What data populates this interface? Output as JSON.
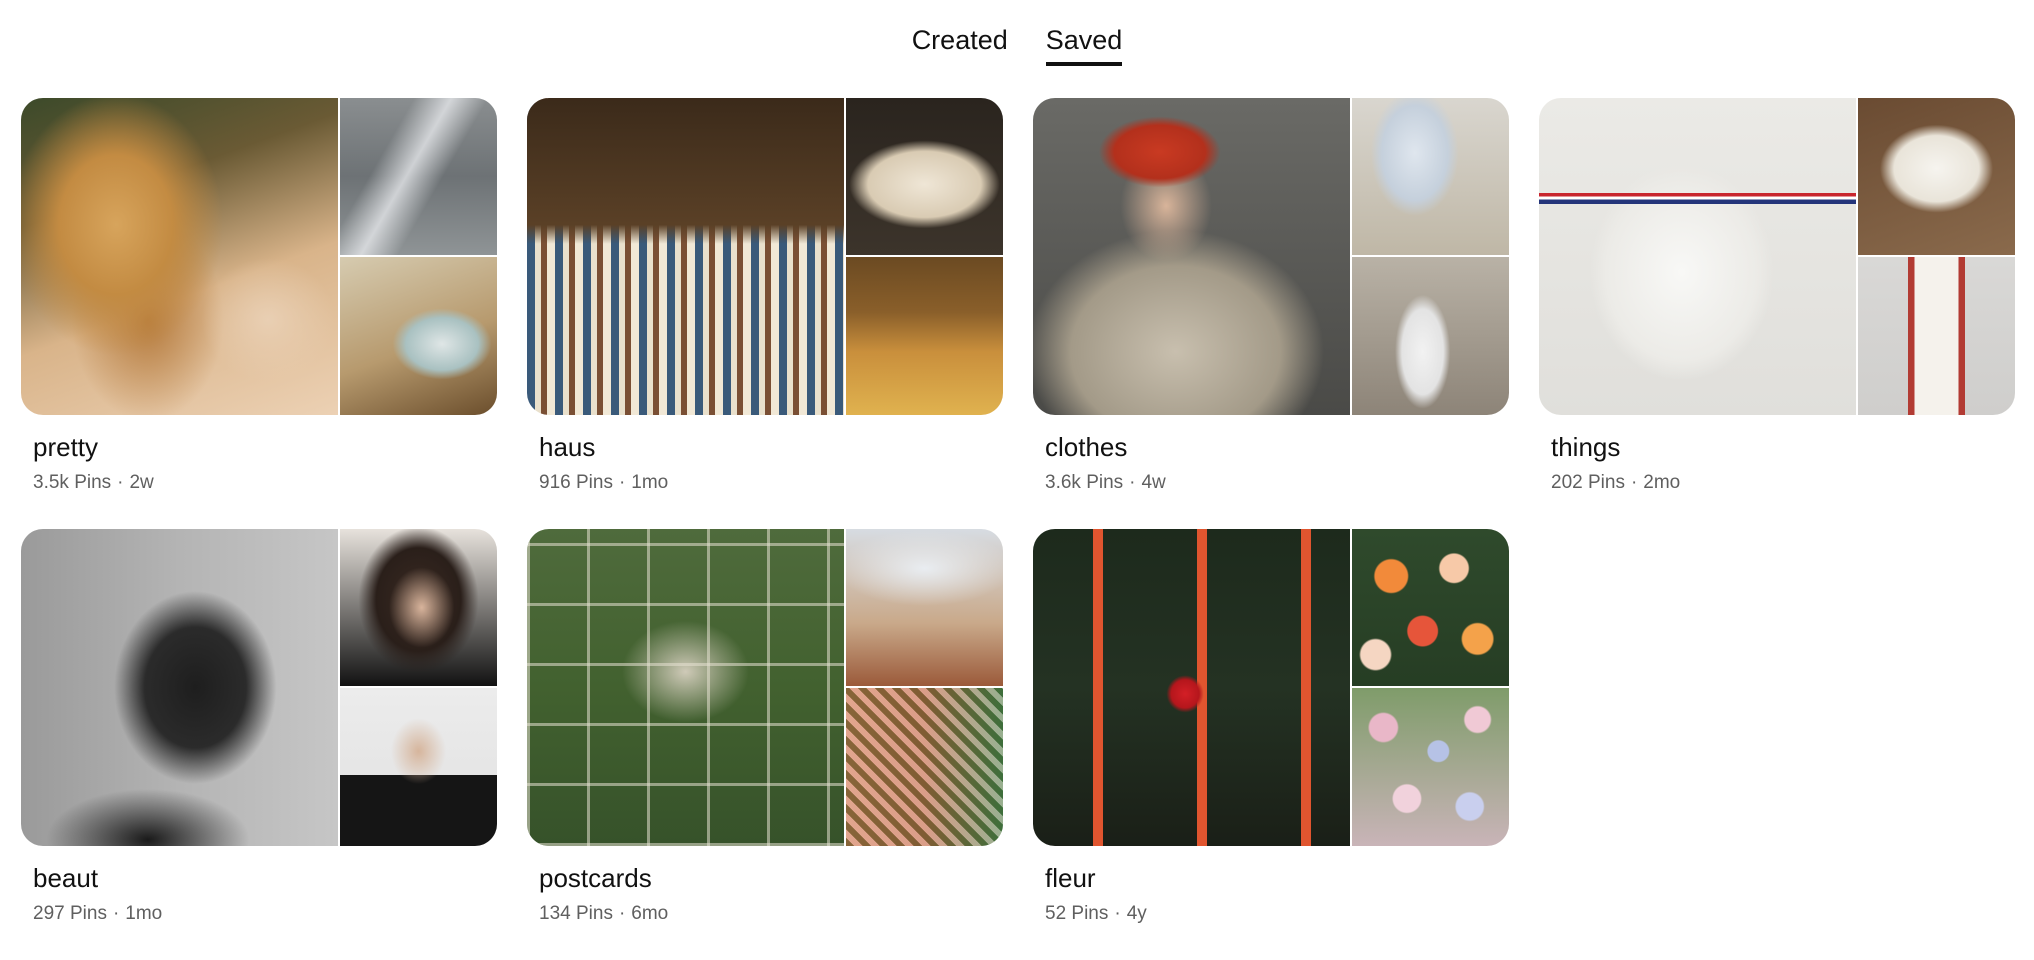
{
  "tabs": [
    {
      "label": "Created",
      "active": false
    },
    {
      "label": "Saved",
      "active": true
    }
  ],
  "boards": [
    {
      "name": "pretty",
      "pins": "3.5k Pins",
      "age": "2w"
    },
    {
      "name": "haus",
      "pins": "916 Pins",
      "age": "1mo"
    },
    {
      "name": "clothes",
      "pins": "3.6k Pins",
      "age": "4w"
    },
    {
      "name": "things",
      "pins": "202 Pins",
      "age": "2mo"
    },
    {
      "name": "beaut",
      "pins": "297 Pins",
      "age": "1mo"
    },
    {
      "name": "postcards",
      "pins": "134 Pins",
      "age": "6mo"
    },
    {
      "name": "fleur",
      "pins": "52 Pins",
      "age": "4y"
    }
  ],
  "separator": "·",
  "colors": {
    "text_primary": "#111111",
    "text_secondary": "#5f5f5f",
    "active_tab_underline": "#111111",
    "background": "#ffffff"
  }
}
